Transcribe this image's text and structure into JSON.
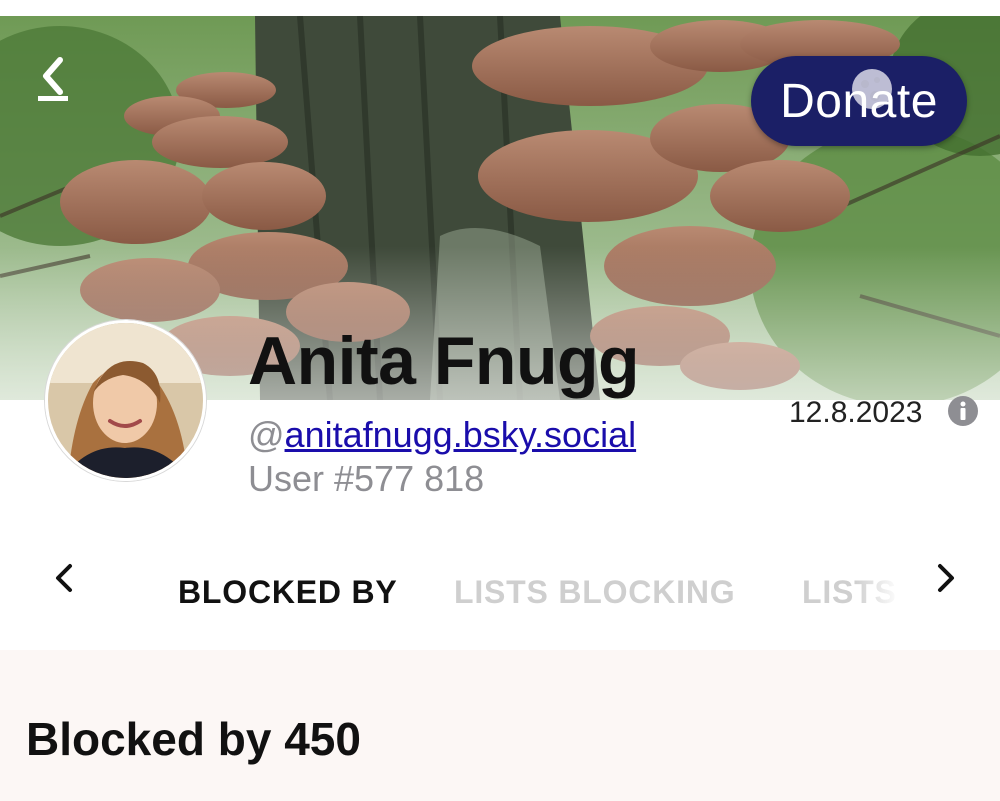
{
  "banner": {
    "description": "mushrooms on tree trunk"
  },
  "header": {
    "back_icon": "chevron-left-icon",
    "donate_label": "Donate"
  },
  "profile": {
    "display_name": "Anita Fnugg",
    "handle_prefix": "@",
    "handle": "anitafnugg.bsky.social",
    "user_number": "User #577 818",
    "joined_date": "12.8.2023",
    "info_icon": "info-icon"
  },
  "tabs": {
    "items": [
      {
        "label": "BLOCKED BY",
        "active": true
      },
      {
        "label": "LISTS BLOCKING",
        "active": false
      },
      {
        "label": "LISTS",
        "active": false
      }
    ],
    "prev_icon": "chevron-left-icon",
    "next_icon": "chevron-right-icon"
  },
  "section": {
    "title": "Blocked by 450"
  },
  "colors": {
    "donate_bg": "#1b1f66",
    "link": "#1a0dab",
    "muted_text": "#8e8e93",
    "inactive_tab": "#cfcfcf"
  }
}
